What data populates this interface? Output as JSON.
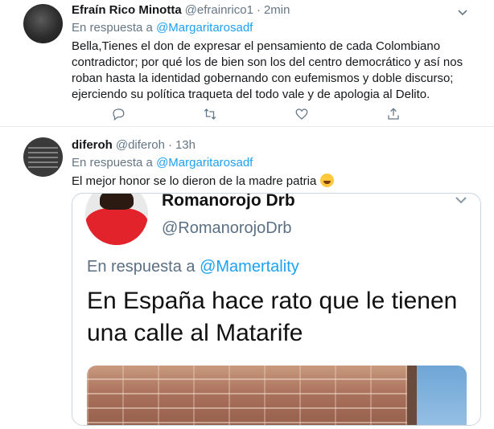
{
  "tweets": [
    {
      "name": "Efraín Rico Minotta",
      "handle": "@efrainrico1",
      "separator": "·",
      "time": "2min",
      "reply_prefix": "En respuesta a",
      "reply_mention": "@Margaritarosadf",
      "text": "Bella,Tienes el don de expresar el pensamiento de cada Colombiano contradictor; por qué los de bien son los del centro democrático y así nos roban hasta la identidad gobernando con eufemismos y doble discurso; ejerciendo su política traqueta del todo vale y de apologia al Delito.",
      "actions": [
        "reply-icon",
        "retweet-icon",
        "like-icon",
        "share-icon"
      ]
    },
    {
      "name": "diferoh",
      "handle": "@diferoh",
      "separator": "·",
      "time": "13h",
      "reply_prefix": "En respuesta a",
      "reply_mention": "@Margaritarosadf",
      "text": "El mejor honor se lo dieron de la madre patria",
      "emoji": "rolling-on-floor-laughing"
    }
  ],
  "embedded": {
    "name": "Romanorojo Drb",
    "handle": "@RomanorojoDrb",
    "reply_prefix": "En respuesta a",
    "reply_mention": "@Mamertality",
    "text": "En España hace rato que le tienen una calle al Matarife"
  },
  "colors": {
    "accent": "#1da1f2",
    "muted": "#657786",
    "text": "#14171a",
    "border": "#e6ecf0"
  }
}
